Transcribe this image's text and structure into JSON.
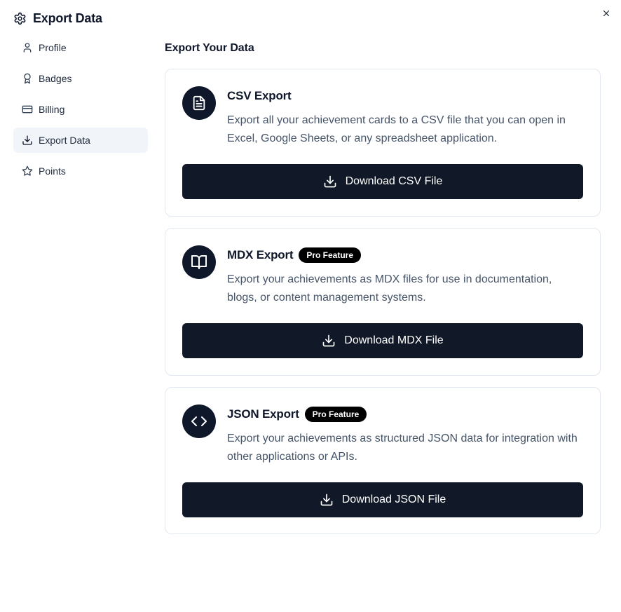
{
  "header": {
    "title": "Export Data"
  },
  "sidebar": {
    "items": [
      {
        "label": "Profile",
        "icon": "user-icon",
        "active": false
      },
      {
        "label": "Badges",
        "icon": "badge-icon",
        "active": false
      },
      {
        "label": "Billing",
        "icon": "credit-card-icon",
        "active": false
      },
      {
        "label": "Export Data",
        "icon": "download-icon",
        "active": true
      },
      {
        "label": "Points",
        "icon": "star-icon",
        "active": false
      }
    ]
  },
  "main": {
    "title": "Export Your Data",
    "cards": [
      {
        "title": "CSV Export",
        "badge": "",
        "icon": "file-text-icon",
        "description": "Export all your achievement cards to a CSV file that you can open in Excel, Google Sheets, or any spreadsheet application.",
        "button_label": "Download CSV File"
      },
      {
        "title": "MDX Export",
        "badge": "Pro Feature",
        "icon": "book-open-icon",
        "description": "Export your achievements as MDX files for use in documentation, blogs, or content management systems.",
        "button_label": "Download MDX File"
      },
      {
        "title": "JSON Export",
        "badge": "Pro Feature",
        "icon": "code-icon",
        "description": "Export your achievements as structured JSON data for integration with other applications or APIs.",
        "button_label": "Download JSON File"
      }
    ]
  },
  "colors": {
    "primary": "#111827",
    "active_nav_bg": "#f1f5f9",
    "card_border": "#e2e8f0",
    "muted_text": "#475569"
  }
}
